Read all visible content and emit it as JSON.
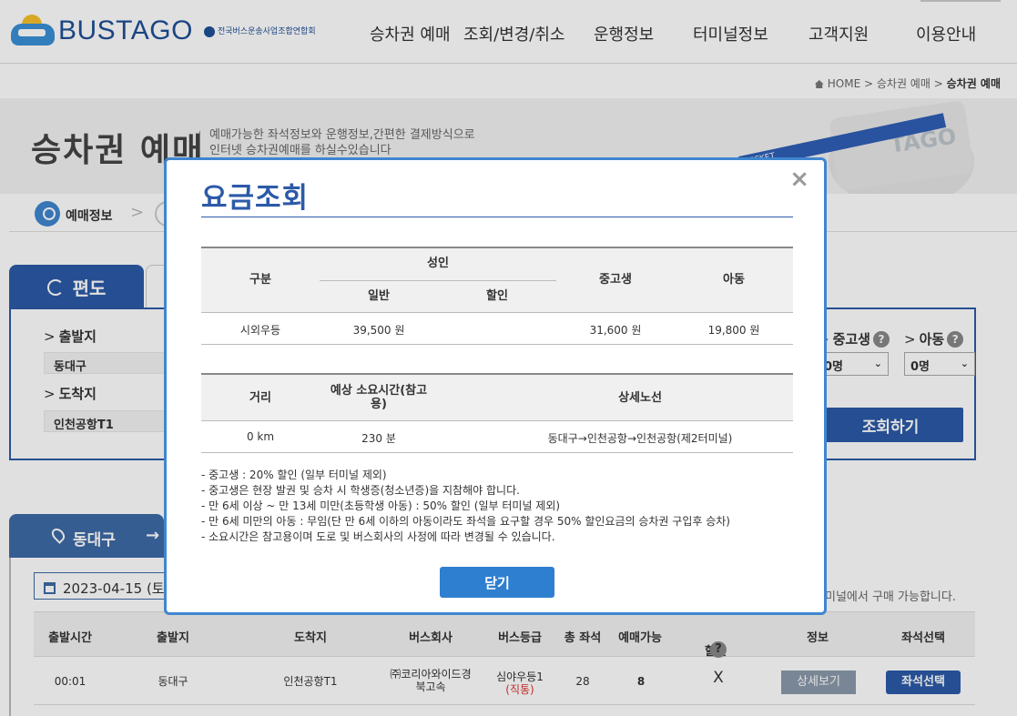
{
  "header": {
    "logo_text": "BUSTAGO",
    "logo_sub": "전국버스운송사업조합연합회",
    "nav": [
      "승차권 예매",
      "조회/변경/취소",
      "운행정보",
      "터미널정보",
      "고객지원",
      "이용안내"
    ]
  },
  "breadcrumb": {
    "home": "HOME",
    "sep": ">",
    "parent": "승차권 예매",
    "current": "승차권 예매"
  },
  "hero": {
    "title": "승차권 예매",
    "desc_line1": "예매가능한 좌석정보와 운행정보,간편한 결제방식으로",
    "desc_line2": "인터넷 승차권예매를 하실수있습니다",
    "ticket_text": "TICKET",
    "card_text": "TAGO"
  },
  "steps": {
    "current": "예매정보",
    "arrow": ">"
  },
  "booking": {
    "tab_oneway": "편도",
    "departure_label": "출발지",
    "departure_value": "동대구",
    "arrival_label": "도착지",
    "arrival_value": "인천공항T1",
    "student_label": "중고생",
    "child_label": "아동",
    "student_value": "0명",
    "child_value": "0명",
    "search_button": "조회하기",
    "caret": "⌄",
    "q": "?"
  },
  "results": {
    "tab_departure": "동대구",
    "tab_arrow": "→",
    "date": "2023-04-15 (토",
    "note": "미널에서 구매 가능합니다.",
    "headers": [
      "출발시간",
      "출발지",
      "도착지",
      "버스회사",
      "버스등급",
      "총 좌석",
      "예매가능",
      "할인",
      "정보",
      "좌석선택"
    ],
    "row": {
      "time": "00:01",
      "from": "동대구",
      "to": "인천공항T1",
      "company_line1": "㈜코리아와이드경",
      "company_line2": "북고속",
      "grade": "심야우등1",
      "grade_sub": "(직통)",
      "total_seats": "28",
      "available": "8",
      "discount": "X",
      "detail_button": "상세보기",
      "seat_button": "좌석선택"
    }
  },
  "modal": {
    "title": "요금조회",
    "close_icon": "×",
    "fare_table": {
      "col_type": "구분",
      "col_adult": "성인",
      "col_general": "일반",
      "col_discount": "할인",
      "col_student": "중고생",
      "col_child": "아동",
      "row": {
        "type": "시외우등",
        "general": "39,500 원",
        "discount": "",
        "student": "31,600 원",
        "child": "19,800 원"
      }
    },
    "route_table": {
      "col_distance": "거리",
      "col_time_line1": "예상 소요시간(참고",
      "col_time_line2": "용)",
      "col_route": "상세노선",
      "row": {
        "distance": "0 km",
        "time": "230 분",
        "route": "동대구→인천공항→인천공항(제2터미널)"
      }
    },
    "notes": [
      "- 중고생 : 20% 할인 (일부 터미널 제외)",
      "- 중고생은 현장 발권 및 승차 시 학생증(청소년증)을 지참해야 합니다.",
      "- 만 6세 이상 ~ 만 13세 미만(초등학생 아동) : 50% 할인 (일부 터미널 제외)",
      "- 만 6세 미만의 아동 : 무임(단 만 6세 이하의 아동이라도 좌석을 요구할 경우 50% 할인요금의 승차권 구입후 승차)",
      "- 소요시간은 참고용이며 도로 및 버스회사의 사정에 따라 변경될 수 있습니다."
    ],
    "close_button": "닫기"
  },
  "colors": {
    "primary": "#2c5aa8",
    "modal_border": "#3f86cf",
    "button": "#2f7fd0"
  }
}
